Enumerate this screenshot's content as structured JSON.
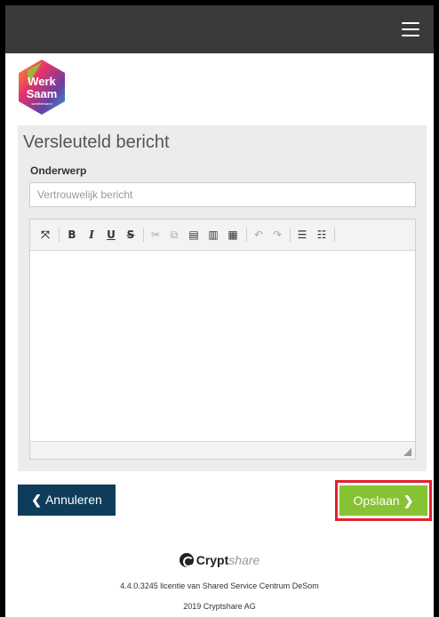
{
  "header": {
    "menu_icon": "hamburger-icon"
  },
  "logo": {
    "line1": "Werk",
    "line2": "Saam",
    "line3": "westfriesland"
  },
  "panel": {
    "title": "Versleuteld bericht",
    "subject_label": "Onderwerp",
    "subject_value": "Vertrouwelijk bericht"
  },
  "toolbar": {
    "items": [
      {
        "icon": "maximize-icon",
        "glyph": "⤧"
      },
      {
        "icon": "bold-icon",
        "glyph": "B"
      },
      {
        "icon": "italic-icon",
        "glyph": "I"
      },
      {
        "icon": "underline-icon",
        "glyph": "U"
      },
      {
        "icon": "strikethrough-icon",
        "glyph": "S"
      },
      {
        "icon": "cut-icon",
        "glyph": "✂"
      },
      {
        "icon": "copy-icon",
        "glyph": "⧉"
      },
      {
        "icon": "paste-icon",
        "glyph": "▤"
      },
      {
        "icon": "paste-text-icon",
        "glyph": "▥"
      },
      {
        "icon": "paste-word-icon",
        "glyph": "▦"
      },
      {
        "icon": "undo-icon",
        "glyph": "↶"
      },
      {
        "icon": "redo-icon",
        "glyph": "↷"
      },
      {
        "icon": "numbered-list-icon",
        "glyph": "☰"
      },
      {
        "icon": "bulleted-list-icon",
        "glyph": "☷"
      }
    ]
  },
  "buttons": {
    "cancel_label": "Annuleren",
    "save_label": "Opslaan"
  },
  "colors": {
    "topbar": "#3a3a3a",
    "cancel": "#0e3d5c",
    "save": "#86c232",
    "highlight": "#e2222b",
    "panel": "#ececec"
  },
  "footer": {
    "brand_crypt": "Crypt",
    "brand_share": "share",
    "license": "4.4.0.3245 licentie van Shared Service Centrum DeSom",
    "copyright": "2019 Cryptshare AG"
  }
}
